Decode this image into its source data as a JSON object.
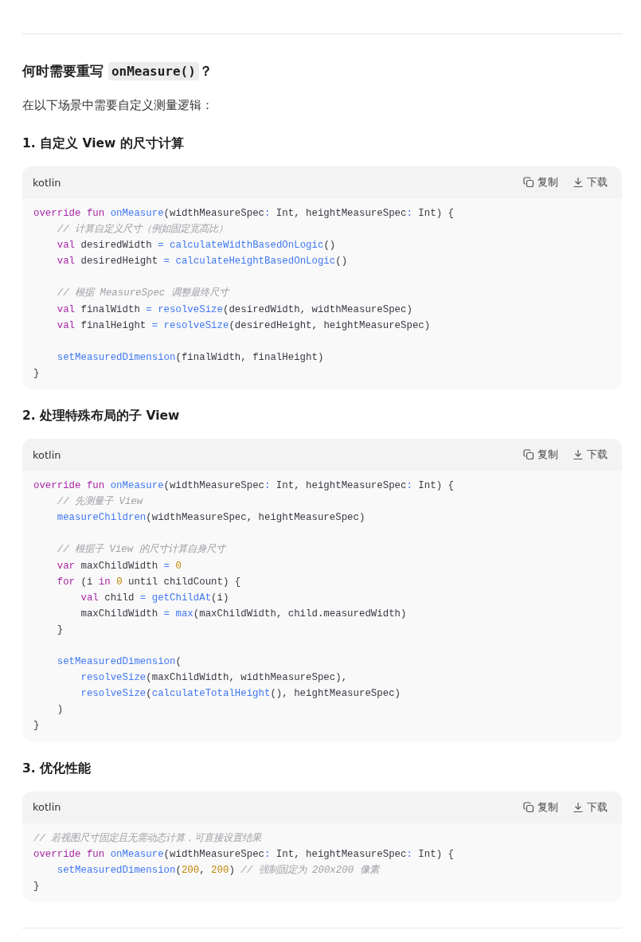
{
  "heading": {
    "text": "何时需要重写 ",
    "code": "onMeasure()",
    "suffix": "？"
  },
  "intro": "在以下场景中需要自定义测量逻辑：",
  "sections": [
    {
      "title": "1. 自定义 View 的尺寸计算",
      "block": {
        "language": "kotlin",
        "copy_label": "复制",
        "download_label": "下载",
        "lines": [
          {
            "kind": "code",
            "tokens": [
              {
                "kind": "keyword",
                "text": "override fun "
              },
              {
                "kind": "function",
                "text": "onMeasure"
              },
              {
                "kind": "plain",
                "text": "(widthMeasureSpec"
              },
              {
                "kind": "operator",
                "text": ":"
              },
              {
                "kind": "plain",
                "text": " Int, heightMeasureSpec"
              },
              {
                "kind": "operator",
                "text": ":"
              },
              {
                "kind": "plain",
                "text": " Int) {"
              }
            ]
          },
          {
            "kind": "code",
            "tokens": [
              {
                "kind": "comment",
                "text": "    // 计算自定义尺寸（例如固定宽高比）"
              }
            ]
          },
          {
            "kind": "code",
            "tokens": [
              {
                "kind": "keyword",
                "text": "    val"
              },
              {
                "kind": "plain",
                "text": " desiredWidth "
              },
              {
                "kind": "operator",
                "text": "= "
              },
              {
                "kind": "function",
                "text": "calculateWidthBasedOnLogic"
              },
              {
                "kind": "plain",
                "text": "()"
              }
            ]
          },
          {
            "kind": "code",
            "tokens": [
              {
                "kind": "keyword",
                "text": "    val"
              },
              {
                "kind": "plain",
                "text": " desiredHeight "
              },
              {
                "kind": "operator",
                "text": "= "
              },
              {
                "kind": "function",
                "text": "calculateHeightBasedOnLogic"
              },
              {
                "kind": "plain",
                "text": "()"
              }
            ]
          },
          {
            "kind": "blank"
          },
          {
            "kind": "code",
            "tokens": [
              {
                "kind": "comment",
                "text": "    // 根据 MeasureSpec 调整最终尺寸"
              }
            ]
          },
          {
            "kind": "code",
            "tokens": [
              {
                "kind": "keyword",
                "text": "    val"
              },
              {
                "kind": "plain",
                "text": " finalWidth "
              },
              {
                "kind": "operator",
                "text": "= "
              },
              {
                "kind": "function",
                "text": "resolveSize"
              },
              {
                "kind": "plain",
                "text": "(desiredWidth, widthMeasureSpec)"
              }
            ]
          },
          {
            "kind": "code",
            "tokens": [
              {
                "kind": "keyword",
                "text": "    val"
              },
              {
                "kind": "plain",
                "text": " finalHeight "
              },
              {
                "kind": "operator",
                "text": "= "
              },
              {
                "kind": "function",
                "text": "resolveSize"
              },
              {
                "kind": "plain",
                "text": "(desiredHeight, heightMeasureSpec)"
              }
            ]
          },
          {
            "kind": "blank"
          },
          {
            "kind": "code",
            "tokens": [
              {
                "kind": "function",
                "text": "    setMeasuredDimension"
              },
              {
                "kind": "plain",
                "text": "(finalWidth, finalHeight)"
              }
            ]
          },
          {
            "kind": "code",
            "tokens": [
              {
                "kind": "plain",
                "text": "}"
              }
            ]
          }
        ]
      }
    },
    {
      "title": "2. 处理特殊布局的子 View",
      "block": {
        "language": "kotlin",
        "copy_label": "复制",
        "download_label": "下载",
        "lines": [
          {
            "kind": "code",
            "tokens": [
              {
                "kind": "keyword",
                "text": "override fun "
              },
              {
                "kind": "function",
                "text": "onMeasure"
              },
              {
                "kind": "plain",
                "text": "(widthMeasureSpec"
              },
              {
                "kind": "operator",
                "text": ":"
              },
              {
                "kind": "plain",
                "text": " Int, heightMeasureSpec"
              },
              {
                "kind": "operator",
                "text": ":"
              },
              {
                "kind": "plain",
                "text": " Int) {"
              }
            ]
          },
          {
            "kind": "code",
            "tokens": [
              {
                "kind": "comment",
                "text": "    // 先测量子 View"
              }
            ]
          },
          {
            "kind": "code",
            "tokens": [
              {
                "kind": "function",
                "text": "    measureChildren"
              },
              {
                "kind": "plain",
                "text": "(widthMeasureSpec, heightMeasureSpec)"
              }
            ]
          },
          {
            "kind": "blank"
          },
          {
            "kind": "code",
            "tokens": [
              {
                "kind": "comment",
                "text": "    // 根据子 View 的尺寸计算自身尺寸"
              }
            ]
          },
          {
            "kind": "code",
            "tokens": [
              {
                "kind": "keyword",
                "text": "    var"
              },
              {
                "kind": "plain",
                "text": " maxChildWidth "
              },
              {
                "kind": "operator",
                "text": "= "
              },
              {
                "kind": "number",
                "text": "0"
              }
            ]
          },
          {
            "kind": "code",
            "tokens": [
              {
                "kind": "keyword",
                "text": "    for"
              },
              {
                "kind": "plain",
                "text": " (i "
              },
              {
                "kind": "keyword",
                "text": "in "
              },
              {
                "kind": "number",
                "text": "0"
              },
              {
                "kind": "plain",
                "text": " until childCount) {"
              }
            ]
          },
          {
            "kind": "code",
            "tokens": [
              {
                "kind": "keyword",
                "text": "        val"
              },
              {
                "kind": "plain",
                "text": " child "
              },
              {
                "kind": "operator",
                "text": "= "
              },
              {
                "kind": "function",
                "text": "getChildAt"
              },
              {
                "kind": "plain",
                "text": "(i)"
              }
            ]
          },
          {
            "kind": "code",
            "tokens": [
              {
                "kind": "plain",
                "text": "        maxChildWidth "
              },
              {
                "kind": "operator",
                "text": "= "
              },
              {
                "kind": "function",
                "text": "max"
              },
              {
                "kind": "plain",
                "text": "(maxChildWidth, child.measuredWidth)"
              }
            ]
          },
          {
            "kind": "code",
            "tokens": [
              {
                "kind": "plain",
                "text": "    }"
              }
            ]
          },
          {
            "kind": "blank"
          },
          {
            "kind": "code",
            "tokens": [
              {
                "kind": "function",
                "text": "    setMeasuredDimension"
              },
              {
                "kind": "plain",
                "text": "("
              }
            ]
          },
          {
            "kind": "code",
            "tokens": [
              {
                "kind": "function",
                "text": "        resolveSize"
              },
              {
                "kind": "plain",
                "text": "(maxChildWidth, widthMeasureSpec),"
              }
            ]
          },
          {
            "kind": "code",
            "tokens": [
              {
                "kind": "function",
                "text": "        resolveSize"
              },
              {
                "kind": "plain",
                "text": "("
              },
              {
                "kind": "function",
                "text": "calculateTotalHeight"
              },
              {
                "kind": "plain",
                "text": "(), heightMeasureSpec)"
              }
            ]
          },
          {
            "kind": "code",
            "tokens": [
              {
                "kind": "plain",
                "text": "    )"
              }
            ]
          },
          {
            "kind": "code",
            "tokens": [
              {
                "kind": "plain",
                "text": "}"
              }
            ]
          }
        ]
      }
    },
    {
      "title": "3. 优化性能",
      "block": {
        "language": "kotlin",
        "copy_label": "复制",
        "download_label": "下载",
        "lines": [
          {
            "kind": "code",
            "tokens": [
              {
                "kind": "comment",
                "text": "// 若视图尺寸固定且无需动态计算，可直接设置结果"
              }
            ]
          },
          {
            "kind": "code",
            "tokens": [
              {
                "kind": "keyword",
                "text": "override fun "
              },
              {
                "kind": "function",
                "text": "onMeasure"
              },
              {
                "kind": "plain",
                "text": "(widthMeasureSpec"
              },
              {
                "kind": "operator",
                "text": ":"
              },
              {
                "kind": "plain",
                "text": " Int, heightMeasureSpec"
              },
              {
                "kind": "operator",
                "text": ":"
              },
              {
                "kind": "plain",
                "text": " Int) {"
              }
            ]
          },
          {
            "kind": "code",
            "tokens": [
              {
                "kind": "function",
                "text": "    setMeasuredDimension"
              },
              {
                "kind": "plain",
                "text": "("
              },
              {
                "kind": "number",
                "text": "200"
              },
              {
                "kind": "plain",
                "text": ", "
              },
              {
                "kind": "number",
                "text": "200"
              },
              {
                "kind": "plain",
                "text": ") "
              },
              {
                "kind": "comment",
                "text": "// 强制固定为 200x200 像素"
              }
            ]
          },
          {
            "kind": "code",
            "tokens": [
              {
                "kind": "plain",
                "text": "}"
              }
            ]
          }
        ]
      }
    }
  ]
}
